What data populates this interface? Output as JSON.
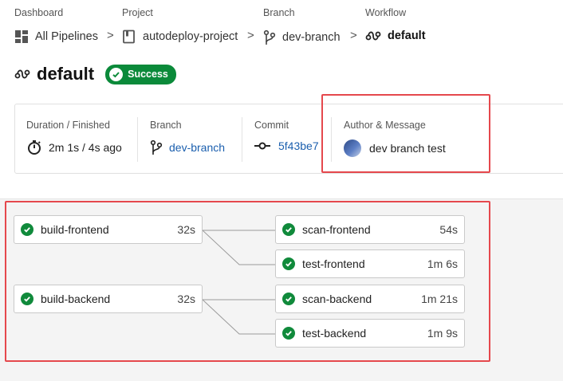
{
  "breadcrumb": [
    {
      "label": "Dashboard",
      "value": "All Pipelines",
      "icon": "dashboard-icon"
    },
    {
      "label": "Project",
      "value": "autodeploy-project",
      "icon": "project-icon"
    },
    {
      "label": "Branch",
      "value": "dev-branch",
      "icon": "branch-icon"
    },
    {
      "label": "Workflow",
      "value": "default",
      "icon": "workflow-icon"
    }
  ],
  "separator": ">",
  "title": "default",
  "status_badge": "Success",
  "info": {
    "duration": {
      "label": "Duration / Finished",
      "value": "2m 1s / 4s ago",
      "icon": "stopwatch-icon"
    },
    "branch": {
      "label": "Branch",
      "value": "dev-branch",
      "icon": "branch-icon"
    },
    "commit": {
      "label": "Commit",
      "value": "5f43be7",
      "icon": "commit-icon"
    },
    "author": {
      "label": "Author & Message",
      "value": "dev branch test",
      "icon": "avatar"
    }
  },
  "jobs": [
    {
      "name": "build-frontend",
      "duration": "32s",
      "status": "success"
    },
    {
      "name": "build-backend",
      "duration": "32s",
      "status": "success"
    },
    {
      "name": "scan-frontend",
      "duration": "54s",
      "status": "success"
    },
    {
      "name": "test-frontend",
      "duration": "1m 6s",
      "status": "success"
    },
    {
      "name": "scan-backend",
      "duration": "1m 21s",
      "status": "success"
    },
    {
      "name": "test-backend",
      "duration": "1m 9s",
      "status": "success"
    }
  ],
  "colors": {
    "success": "#0b8a3a",
    "link": "#1b5fae",
    "highlight": "#e5484d"
  }
}
